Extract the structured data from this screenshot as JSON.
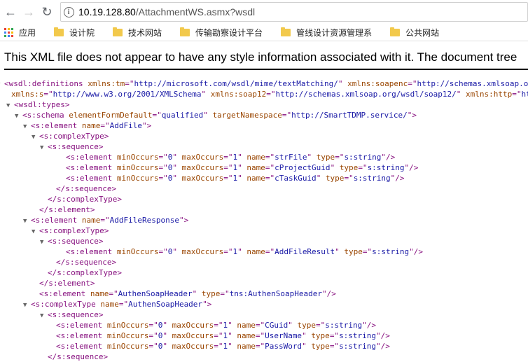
{
  "browser": {
    "back_icon": "arrow-left-icon",
    "forward_icon": "arrow-right-icon",
    "reload_icon": "reload-icon",
    "info_icon": "info-icon",
    "url_host": "10.19.128.80",
    "url_path": "/AttachmentWS.asmx?wsdl"
  },
  "bookmarks": [
    {
      "label": "应用",
      "icon": "apps-grid-icon"
    },
    {
      "label": "设计院",
      "icon": "folder-icon"
    },
    {
      "label": "技术网站",
      "icon": "folder-icon"
    },
    {
      "label": "传输勘察设计平台",
      "icon": "folder-icon"
    },
    {
      "label": "管线设计资源管理系",
      "icon": "folder-icon"
    },
    {
      "label": "公共网站",
      "icon": "folder-icon"
    }
  ],
  "notice": "This XML file does not appear to have any style information associated with it. The document tree",
  "xml_lines": [
    {
      "t": "▼",
      "p": [
        [
          "tag",
          "<wsdl:definitions "
        ],
        [
          "attr",
          "xmlns:tm"
        ],
        [
          "tag",
          "=\""
        ],
        [
          "val",
          "http://microsoft.com/wsdl/mime/textMatching/"
        ],
        [
          "tag",
          "\" "
        ],
        [
          "attr",
          "xmlns:soapenc"
        ],
        [
          "tag",
          "=\""
        ],
        [
          "val",
          "http://schemas.xmlsoap.org"
        ]
      ]
    },
    {
      "t": "",
      "p": [
        [
          "attr",
          "xmlns:s"
        ],
        [
          "tag",
          "=\""
        ],
        [
          "val",
          "http://www.w3.org/2001/XMLSchema"
        ],
        [
          "tag",
          "\" "
        ],
        [
          "attr",
          "xmlns:soap12"
        ],
        [
          "tag",
          "=\""
        ],
        [
          "val",
          "http://schemas.xmlsoap.org/wsdl/soap12/"
        ],
        [
          "tag",
          "\" "
        ],
        [
          "attr",
          "xmlns:http"
        ],
        [
          "tag",
          "=\""
        ],
        [
          "val",
          "http"
        ]
      ]
    },
    {
      "t": "▼",
      "p": [
        [
          "tag",
          "<wsdl:types>"
        ]
      ]
    },
    {
      "t": "▼",
      "p": [
        [
          "tag",
          "<s:schema "
        ],
        [
          "attr",
          "elementFormDefault"
        ],
        [
          "tag",
          "=\""
        ],
        [
          "val",
          "qualified"
        ],
        [
          "tag",
          "\" "
        ],
        [
          "attr",
          "targetNamespace"
        ],
        [
          "tag",
          "=\""
        ],
        [
          "val",
          "http://SmartTDMP.service/"
        ],
        [
          "tag",
          "\">"
        ]
      ]
    },
    {
      "t": "▼",
      "p": [
        [
          "tag",
          "<s:element "
        ],
        [
          "attr",
          "name"
        ],
        [
          "tag",
          "=\""
        ],
        [
          "val",
          "AddFile"
        ],
        [
          "tag",
          "\">"
        ]
      ]
    },
    {
      "t": "▼",
      "p": [
        [
          "tag",
          "<s:complexType>"
        ]
      ]
    },
    {
      "t": "▼",
      "p": [
        [
          "tag",
          "<s:sequence>"
        ]
      ]
    },
    {
      "t": "",
      "p": [
        [
          "tag",
          "<s:element "
        ],
        [
          "attr",
          "minOccurs"
        ],
        [
          "tag",
          "=\""
        ],
        [
          "val",
          "0"
        ],
        [
          "tag",
          "\" "
        ],
        [
          "attr",
          "maxOccurs"
        ],
        [
          "tag",
          "=\""
        ],
        [
          "val",
          "1"
        ],
        [
          "tag",
          "\" "
        ],
        [
          "attr",
          "name"
        ],
        [
          "tag",
          "=\""
        ],
        [
          "val",
          "strFile"
        ],
        [
          "tag",
          "\" "
        ],
        [
          "attr",
          "type"
        ],
        [
          "tag",
          "=\""
        ],
        [
          "val",
          "s:string"
        ],
        [
          "tag",
          "\"/>"
        ]
      ]
    },
    {
      "t": "",
      "p": [
        [
          "tag",
          "<s:element "
        ],
        [
          "attr",
          "minOccurs"
        ],
        [
          "tag",
          "=\""
        ],
        [
          "val",
          "0"
        ],
        [
          "tag",
          "\" "
        ],
        [
          "attr",
          "maxOccurs"
        ],
        [
          "tag",
          "=\""
        ],
        [
          "val",
          "1"
        ],
        [
          "tag",
          "\" "
        ],
        [
          "attr",
          "name"
        ],
        [
          "tag",
          "=\""
        ],
        [
          "val",
          "cProjectGuid"
        ],
        [
          "tag",
          "\" "
        ],
        [
          "attr",
          "type"
        ],
        [
          "tag",
          "=\""
        ],
        [
          "val",
          "s:string"
        ],
        [
          "tag",
          "\"/>"
        ]
      ]
    },
    {
      "t": "",
      "p": [
        [
          "tag",
          "<s:element "
        ],
        [
          "attr",
          "minOccurs"
        ],
        [
          "tag",
          "=\""
        ],
        [
          "val",
          "0"
        ],
        [
          "tag",
          "\" "
        ],
        [
          "attr",
          "maxOccurs"
        ],
        [
          "tag",
          "=\""
        ],
        [
          "val",
          "1"
        ],
        [
          "tag",
          "\" "
        ],
        [
          "attr",
          "name"
        ],
        [
          "tag",
          "=\""
        ],
        [
          "val",
          "cTaskGuid"
        ],
        [
          "tag",
          "\" "
        ],
        [
          "attr",
          "type"
        ],
        [
          "tag",
          "=\""
        ],
        [
          "val",
          "s:string"
        ],
        [
          "tag",
          "\"/>"
        ]
      ]
    },
    {
      "t": "",
      "p": [
        [
          "tag",
          "</s:sequence>"
        ]
      ]
    },
    {
      "t": "",
      "p": [
        [
          "tag",
          "</s:complexType>"
        ]
      ]
    },
    {
      "t": "",
      "p": [
        [
          "tag",
          "</s:element>"
        ]
      ]
    },
    {
      "t": "▼",
      "p": [
        [
          "tag",
          "<s:element "
        ],
        [
          "attr",
          "name"
        ],
        [
          "tag",
          "=\""
        ],
        [
          "val",
          "AddFileResponse"
        ],
        [
          "tag",
          "\">"
        ]
      ]
    },
    {
      "t": "▼",
      "p": [
        [
          "tag",
          "<s:complexType>"
        ]
      ]
    },
    {
      "t": "▼",
      "p": [
        [
          "tag",
          "<s:sequence>"
        ]
      ]
    },
    {
      "t": "",
      "p": [
        [
          "tag",
          "<s:element "
        ],
        [
          "attr",
          "minOccurs"
        ],
        [
          "tag",
          "=\""
        ],
        [
          "val",
          "0"
        ],
        [
          "tag",
          "\" "
        ],
        [
          "attr",
          "maxOccurs"
        ],
        [
          "tag",
          "=\""
        ],
        [
          "val",
          "1"
        ],
        [
          "tag",
          "\" "
        ],
        [
          "attr",
          "name"
        ],
        [
          "tag",
          "=\""
        ],
        [
          "val",
          "AddFileResult"
        ],
        [
          "tag",
          "\" "
        ],
        [
          "attr",
          "type"
        ],
        [
          "tag",
          "=\""
        ],
        [
          "val",
          "s:string"
        ],
        [
          "tag",
          "\"/>"
        ]
      ]
    },
    {
      "t": "",
      "p": [
        [
          "tag",
          "</s:sequence>"
        ]
      ]
    },
    {
      "t": "",
      "p": [
        [
          "tag",
          "</s:complexType>"
        ]
      ]
    },
    {
      "t": "",
      "p": [
        [
          "tag",
          "</s:element>"
        ]
      ]
    },
    {
      "t": "",
      "p": [
        [
          "tag",
          "<s:element "
        ],
        [
          "attr",
          "name"
        ],
        [
          "tag",
          "=\""
        ],
        [
          "val",
          "AuthenSoapHeader"
        ],
        [
          "tag",
          "\" "
        ],
        [
          "attr",
          "type"
        ],
        [
          "tag",
          "=\""
        ],
        [
          "val",
          "tns:AuthenSoapHeader"
        ],
        [
          "tag",
          "\"/>"
        ]
      ]
    },
    {
      "t": "▼",
      "p": [
        [
          "tag",
          "<s:complexType "
        ],
        [
          "attr",
          "name"
        ],
        [
          "tag",
          "=\""
        ],
        [
          "val",
          "AuthenSoapHeader"
        ],
        [
          "tag",
          "\">"
        ]
      ]
    },
    {
      "t": "▼",
      "p": [
        [
          "tag",
          "<s:sequence>"
        ]
      ]
    },
    {
      "t": "",
      "p": [
        [
          "tag",
          "<s:element "
        ],
        [
          "attr",
          "minOccurs"
        ],
        [
          "tag",
          "=\""
        ],
        [
          "val",
          "0"
        ],
        [
          "tag",
          "\" "
        ],
        [
          "attr",
          "maxOccurs"
        ],
        [
          "tag",
          "=\""
        ],
        [
          "val",
          "1"
        ],
        [
          "tag",
          "\" "
        ],
        [
          "attr",
          "name"
        ],
        [
          "tag",
          "=\""
        ],
        [
          "val",
          "CGuid"
        ],
        [
          "tag",
          "\" "
        ],
        [
          "attr",
          "type"
        ],
        [
          "tag",
          "=\""
        ],
        [
          "val",
          "s:string"
        ],
        [
          "tag",
          "\"/>"
        ]
      ]
    },
    {
      "t": "",
      "p": [
        [
          "tag",
          "<s:element "
        ],
        [
          "attr",
          "minOccurs"
        ],
        [
          "tag",
          "=\""
        ],
        [
          "val",
          "0"
        ],
        [
          "tag",
          "\" "
        ],
        [
          "attr",
          "maxOccurs"
        ],
        [
          "tag",
          "=\""
        ],
        [
          "val",
          "1"
        ],
        [
          "tag",
          "\" "
        ],
        [
          "attr",
          "name"
        ],
        [
          "tag",
          "=\""
        ],
        [
          "val",
          "UserName"
        ],
        [
          "tag",
          "\" "
        ],
        [
          "attr",
          "type"
        ],
        [
          "tag",
          "=\""
        ],
        [
          "val",
          "s:string"
        ],
        [
          "tag",
          "\"/>"
        ]
      ]
    },
    {
      "t": "",
      "p": [
        [
          "tag",
          "<s:element "
        ],
        [
          "attr",
          "minOccurs"
        ],
        [
          "tag",
          "=\""
        ],
        [
          "val",
          "0"
        ],
        [
          "tag",
          "\" "
        ],
        [
          "attr",
          "maxOccurs"
        ],
        [
          "tag",
          "=\""
        ],
        [
          "val",
          "1"
        ],
        [
          "tag",
          "\" "
        ],
        [
          "attr",
          "name"
        ],
        [
          "tag",
          "=\""
        ],
        [
          "val",
          "PassWord"
        ],
        [
          "tag",
          "\" "
        ],
        [
          "attr",
          "type"
        ],
        [
          "tag",
          "=\""
        ],
        [
          "val",
          "s:string"
        ],
        [
          "tag",
          "\"/>"
        ]
      ]
    },
    {
      "t": "",
      "p": [
        [
          "tag",
          "</s:sequence>"
        ]
      ]
    }
  ]
}
